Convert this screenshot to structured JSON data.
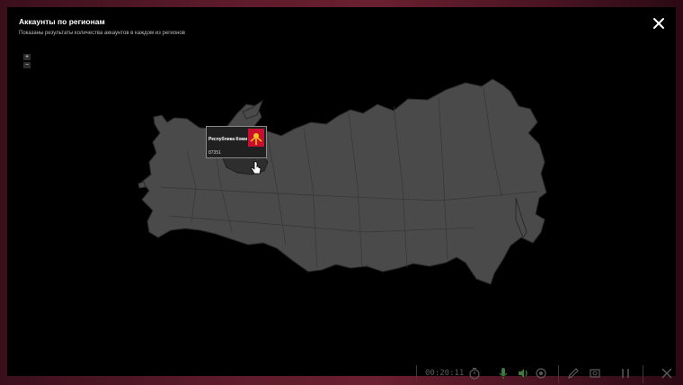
{
  "modal": {
    "title": "Аккаунты по регионам",
    "subtitle": "Показаны результаты количества аккаунтов в каждом из регионов"
  },
  "zoom": {
    "in_label": "+",
    "out_label": "−"
  },
  "tooltip": {
    "region": "Республика Коми",
    "accounts": "87351"
  },
  "colors": {
    "map_fill": "#4a4a4a",
    "map_border": "#2a2a2a",
    "highlight": "#2e2e2e",
    "flag_red": "#c8102e",
    "flag_gold": "#f2c21d"
  },
  "recorder": {
    "elapsed": "00:20:11"
  }
}
